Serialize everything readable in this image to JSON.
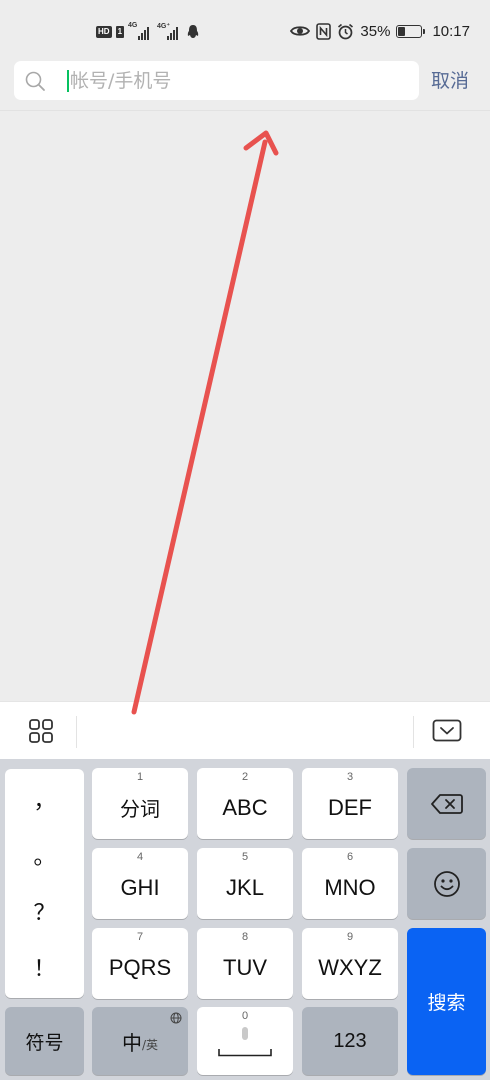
{
  "status_bar": {
    "hd": "HD",
    "sim": "1",
    "net1": "4G",
    "net2": "4G⁺",
    "battery_level": 0.35,
    "battery_text": "35%",
    "time": "10:17"
  },
  "search": {
    "placeholder": "帐号/手机号",
    "value": "",
    "cancel_label": "取消"
  },
  "keyboard": {
    "punctuation": [
      "，",
      "。",
      "？",
      "！"
    ],
    "keys": [
      {
        "num": "1",
        "label": "分词"
      },
      {
        "num": "2",
        "label": "ABC"
      },
      {
        "num": "3",
        "label": "DEF"
      },
      {
        "num": "4",
        "label": "GHI"
      },
      {
        "num": "5",
        "label": "JKL"
      },
      {
        "num": "6",
        "label": "MNO"
      },
      {
        "num": "7",
        "label": "PQRS"
      },
      {
        "num": "8",
        "label": "TUV"
      },
      {
        "num": "9",
        "label": "WXYZ"
      }
    ],
    "symbols_label": "符号",
    "lang_main": "中",
    "lang_sub": "/英",
    "space_num": "0",
    "numbers_label": "123",
    "search_key_label": "搜索",
    "accent_color": "#0a63f3"
  },
  "icons": [
    "search-icon",
    "toolbar-grid-icon",
    "keyboard-collapse-icon",
    "backspace-icon",
    "emoji-icon",
    "globe-icon",
    "mic-icon",
    "eye-icon",
    "nfc-icon",
    "alarm-icon",
    "notification-icon"
  ],
  "colors": {
    "background": "#ededed",
    "cursor": "#07c160",
    "cancel": "#576b95",
    "annotation_arrow": "#e8524f"
  }
}
